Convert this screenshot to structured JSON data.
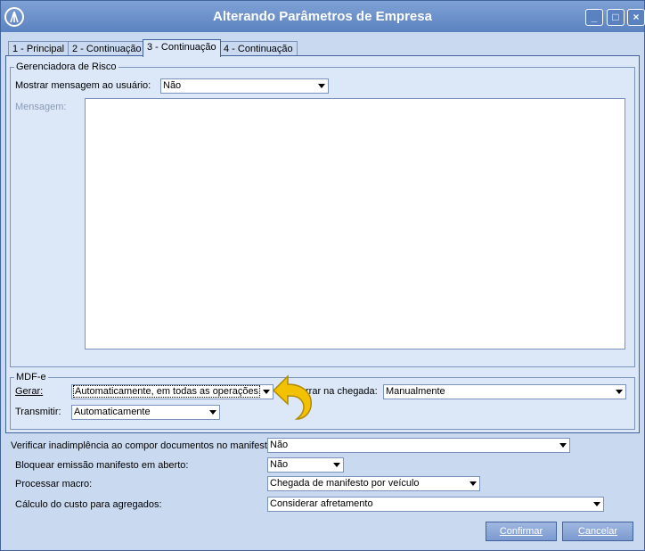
{
  "window": {
    "title": "Alterando Parâmetros de Empresa"
  },
  "tabs": [
    "1 - Principal",
    "2 - Continuação",
    "3 - Continuação",
    "4 - Continuação"
  ],
  "active_tab": 2,
  "risk_group": {
    "legend": "Gerenciadora de Risco",
    "show_message_label": "Mostrar mensagem ao usuário:",
    "show_message_value": "Não",
    "message_label": "Mensagem:",
    "message_value": ""
  },
  "mdfe_group": {
    "legend": "MDF-e",
    "gerar_label": "Gerar:",
    "gerar_value": "Automaticamente, em todas as operações",
    "encerrar_label": "rrar na chegada:",
    "encerrar_value": "Manualmente",
    "transmitir_label": "Transmitir:",
    "transmitir_value": "Automaticamente"
  },
  "fields": {
    "inadimplencia_label": "Verificar inadimplência ao compor documentos no manifesto:",
    "inadimplencia_value": "Não",
    "bloquear_label": "Bloquear emissão manifesto em aberto:",
    "bloquear_value": "Não",
    "macro_label": "Processar macro:",
    "macro_value": "Chegada de manifesto por veículo",
    "custo_label": "Cálculo do custo para agregados:",
    "custo_value": "Considerar afretamento"
  },
  "buttons": {
    "confirm": "Confirmar",
    "cancel": "Cancelar"
  },
  "colors": {
    "titlebar": "#5b82c0",
    "window_bg": "#c9d9f0",
    "panel_bg": "#dce7f7",
    "pointer": "#f2c200"
  }
}
